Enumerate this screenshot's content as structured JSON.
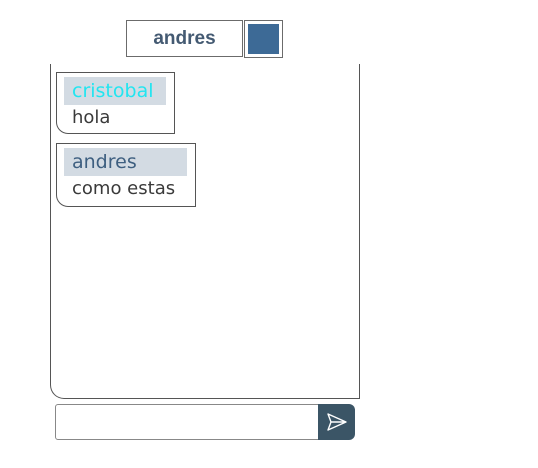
{
  "header": {
    "username": "andres",
    "user_color": "#3d6a96"
  },
  "chat": {
    "messages": [
      {
        "sender": "cristobal",
        "text": "hola",
        "sender_color": "#22e5f0"
      },
      {
        "sender": "andres",
        "text": "como estas",
        "sender_color": "#3e5f80"
      }
    ]
  },
  "composer": {
    "input_value": "",
    "placeholder": "",
    "send_icon": "send-icon",
    "send_button_color": "#3b5566"
  }
}
